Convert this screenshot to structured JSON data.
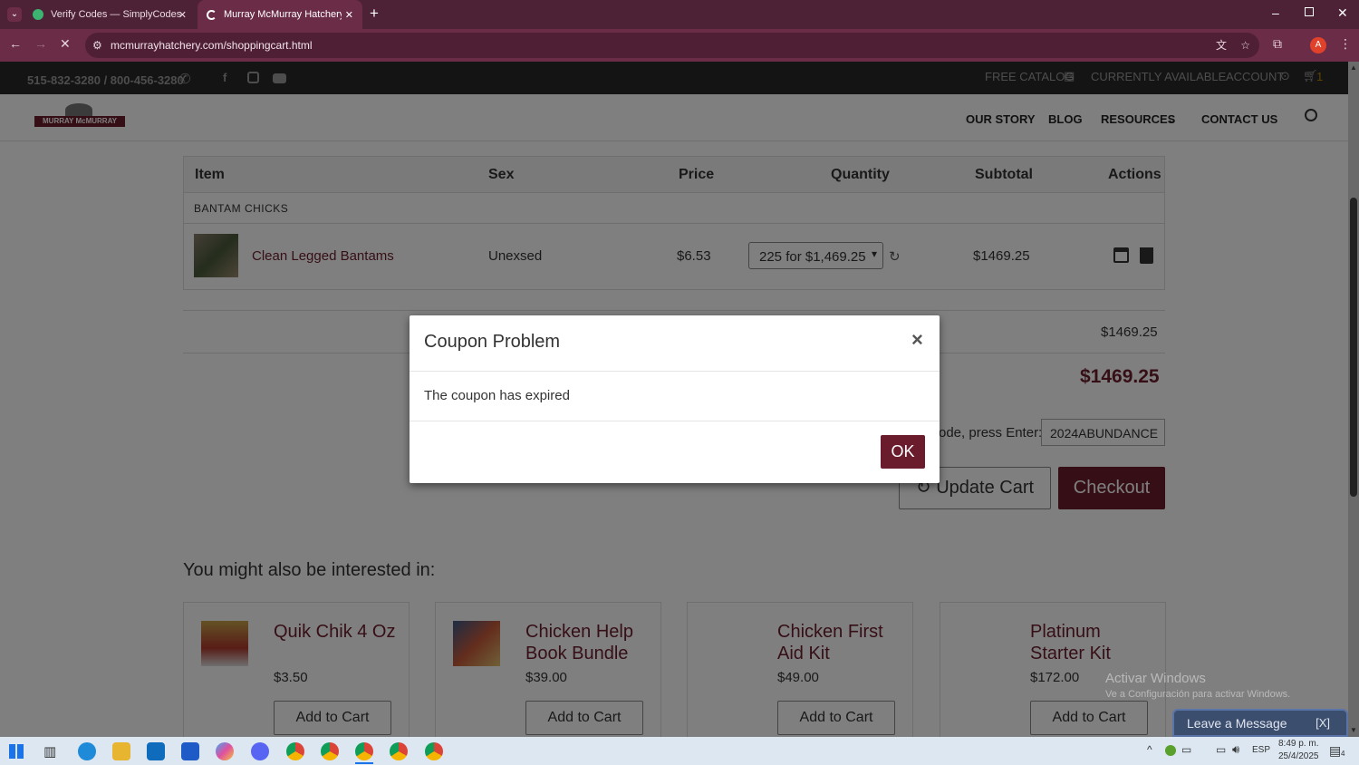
{
  "browser": {
    "tabs": [
      {
        "title": "Verify Codes — SimplyCodes"
      },
      {
        "title": "Murray McMurray Hatchery - S"
      }
    ],
    "url": "mcmurrayhatchery.com/shoppingcart.html",
    "new_tab": "+"
  },
  "site": {
    "phone": "515-832-3280 / 800-456-3280",
    "top_links": [
      "FREE CATALOG",
      "CURRENTLY AVAILABLE",
      "ACCOUNT"
    ],
    "cart_count": "1",
    "logo_text": "MURRAY McMURRAY",
    "nav": [
      "OUR STORY",
      "BLOG",
      "RESOURCES",
      "CONTACT US"
    ]
  },
  "cart": {
    "headers": [
      "Item",
      "Sex",
      "Price",
      "Quantity",
      "Subtotal",
      "Actions"
    ],
    "category": "BANTAM CHICKS",
    "item": {
      "name": "Clean Legged Bantams",
      "sex": "Unexsed",
      "price": "$6.53",
      "quantity": "225 for $1,469.25",
      "subtotal": "$1469.25"
    },
    "subtotal_row": "$1469.25",
    "total": "$1469.25",
    "coupon_label": "ode, press Enter:",
    "coupon_value": "2024ABUNDANCE",
    "update_label": "Update Cart",
    "checkout_label": "Checkout"
  },
  "recommend": {
    "heading": "You might also be interested in:",
    "items": [
      {
        "title": "Quik Chik 4 Oz",
        "price": "$3.50",
        "button": "Add to Cart"
      },
      {
        "title": "Chicken Help Book Bundle",
        "price": "$39.00",
        "button": "Add to Cart"
      },
      {
        "title": "Chicken First Aid Kit",
        "price": "$49.00",
        "button": "Add to Cart"
      },
      {
        "title": "Platinum Starter Kit",
        "price": "$172.00",
        "button": "Add to Cart"
      }
    ]
  },
  "modal": {
    "title": "Coupon Problem",
    "close": "×",
    "message": "The coupon has expired",
    "ok": "OK"
  },
  "watermark": {
    "title": "Activar Windows",
    "subtitle": "Ve a Configuración para activar Windows."
  },
  "chat": {
    "label": "Leave a Message",
    "close": "[X]"
  },
  "taskbar": {
    "lang": "ESP",
    "time": "8:49 p. m.",
    "date": "25/4/2025",
    "notif": "4"
  },
  "colors": {
    "brand": "#6b1c2c",
    "chrome": "#6b2c48"
  }
}
